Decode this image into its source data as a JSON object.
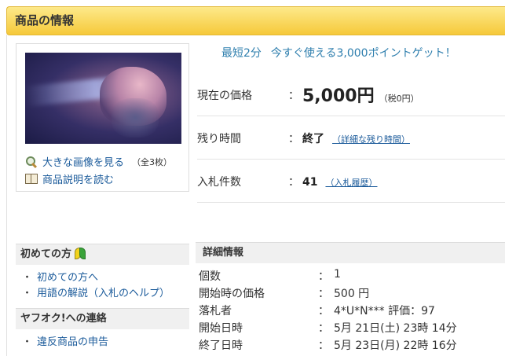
{
  "header": {
    "title": "商品の情報"
  },
  "image_panel": {
    "view_large_label": "大きな画像を見る",
    "image_count": "（全3枚）",
    "read_description_label": "商品説明を読む"
  },
  "promo": {
    "part1": "最短2分",
    "part2": "今すぐ使える3,000ポイントゲット！"
  },
  "price": {
    "label": "現在の価格",
    "colon": "：",
    "value": "5,000円",
    "tax": "（税0円）"
  },
  "time_left": {
    "label": "残り時間",
    "colon": "：",
    "value": "終了",
    "detail_link": "（詳細な残り時間）"
  },
  "bids": {
    "label": "入札件数",
    "colon": "：",
    "value": "41",
    "history_link": "（入札履歴）"
  },
  "sidebar": {
    "beginners_title": "初めての方",
    "beginners_links": [
      "初めての方へ",
      "用語の解説（入札のヘルプ）"
    ],
    "contact_title": "ヤフオク!への連絡",
    "contact_links": [
      "違反商品の申告"
    ]
  },
  "details": {
    "title": "詳細情報",
    "rows": [
      {
        "label": "個数",
        "colon": "：",
        "value": "1"
      },
      {
        "label": "開始時の価格",
        "colon": "：",
        "value": "500 円"
      },
      {
        "label": "落札者",
        "colon": "：",
        "value": "4*U*N*** 評価：97"
      },
      {
        "label": "開始日時",
        "colon": "：",
        "value": "5月 21日(土) 23時 14分"
      },
      {
        "label": "終了日時",
        "colon": "：",
        "value": "5月 23日(月) 22時 16分"
      }
    ]
  },
  "colors": {
    "header_bg": "#f6c93a",
    "link": "#1a5a9a",
    "promo": "#2f7fae"
  }
}
